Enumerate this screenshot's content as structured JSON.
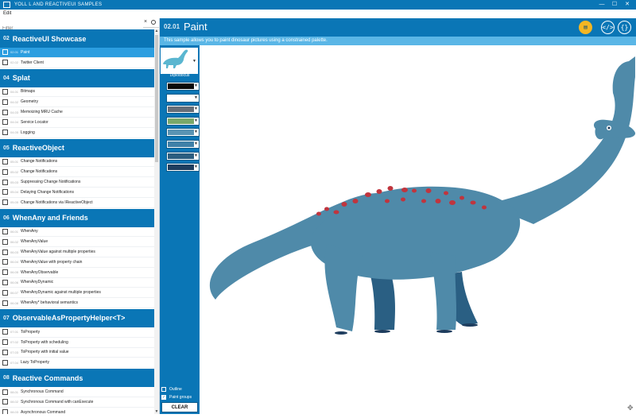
{
  "window": {
    "title": "YOLL L AND REACTIVEUI SAMPLES",
    "minimize": "—",
    "maximize": "☐",
    "close": "✕"
  },
  "menu": {
    "edit": "Edit"
  },
  "filter": {
    "placeholder": "Filter",
    "clear": "×"
  },
  "sections": [
    {
      "num": "02",
      "title": "ReactiveUI Showcase",
      "items": [
        {
          "code": "02.01",
          "label": "Paint",
          "selected": true
        },
        {
          "code": "02.02",
          "label": "Twitter Client"
        }
      ]
    },
    {
      "num": "04",
      "title": "Splat",
      "items": [
        {
          "code": "04.01",
          "label": "Bitmaps"
        },
        {
          "code": "04.02",
          "label": "Geometry"
        },
        {
          "code": "04.03",
          "label": "Memoizing MRU Cache"
        },
        {
          "code": "04.04",
          "label": "Service Locator"
        },
        {
          "code": "04.05",
          "label": "Logging"
        }
      ]
    },
    {
      "num": "05",
      "title": "ReactiveObject",
      "items": [
        {
          "code": "05.01",
          "label": "Change Notifications"
        },
        {
          "code": "05.02",
          "label": "Change Notifications"
        },
        {
          "code": "05.03",
          "label": "Suppressing Change Notifications"
        },
        {
          "code": "05.04",
          "label": "Delaying Change Notifications"
        },
        {
          "code": "05.05",
          "label": "Change Notifications via IReactiveObject"
        }
      ]
    },
    {
      "num": "06",
      "title": "WhenAny and Friends",
      "items": [
        {
          "code": "06.01",
          "label": "WhenAny"
        },
        {
          "code": "06.02",
          "label": "WhenAnyValue"
        },
        {
          "code": "06.03",
          "label": "WhenAnyValue against multiple properties"
        },
        {
          "code": "06.04",
          "label": "WhenAnyValue with property chain"
        },
        {
          "code": "06.05",
          "label": "WhenAnyObservable"
        },
        {
          "code": "06.06",
          "label": "WhenAnyDynamic"
        },
        {
          "code": "06.07",
          "label": "WhenAnyDynamic against multiple properties"
        },
        {
          "code": "06.08",
          "label": "WhenAny* behavioral semantics"
        }
      ]
    },
    {
      "num": "07",
      "title": "ObservableAsPropertyHelper<T>",
      "items": [
        {
          "code": "07.01",
          "label": "ToProperty"
        },
        {
          "code": "07.02",
          "label": "ToProperty with scheduling"
        },
        {
          "code": "07.03",
          "label": "ToProperty with initial value"
        },
        {
          "code": "07.04",
          "label": "Lazy ToProperty"
        }
      ]
    },
    {
      "num": "08",
      "title": "Reactive Commands",
      "items": [
        {
          "code": "08.01",
          "label": "Synchronous Command"
        },
        {
          "code": "08.02",
          "label": "Synchronous Command with canExecute"
        },
        {
          "code": "08.03",
          "label": "Asynchronous Command"
        }
      ]
    }
  ],
  "header": {
    "num": "02.01",
    "title": "Paint",
    "book_icon": "book-icon",
    "code_icon": "</>",
    "json_icon": "{}"
  },
  "description": "This sample allows you to paint dinosaur pictures using a constrained palette.",
  "palette": {
    "dinosaur": "Diplodocus",
    "colors": [
      "#0a0a0a",
      "#ffffff",
      "#666e78",
      "#79a86a",
      "#5a93b3",
      "#3f80a8",
      "#2c5e80",
      "#1e3d5e"
    ],
    "outline_label": "Outline",
    "outline_checked": false,
    "paint_groups_label": "Paint groups",
    "paint_groups_checked": true,
    "clear_label": "CLEAR"
  },
  "colors": {
    "accent": "#0a76b6",
    "accent_light": "#5ab6e6",
    "selected": "#2c9ee0",
    "dino_body": "#4f8aa9",
    "dino_dark": "#2a5f83",
    "spots": "#c0353e",
    "book_button": "#f4b623"
  }
}
